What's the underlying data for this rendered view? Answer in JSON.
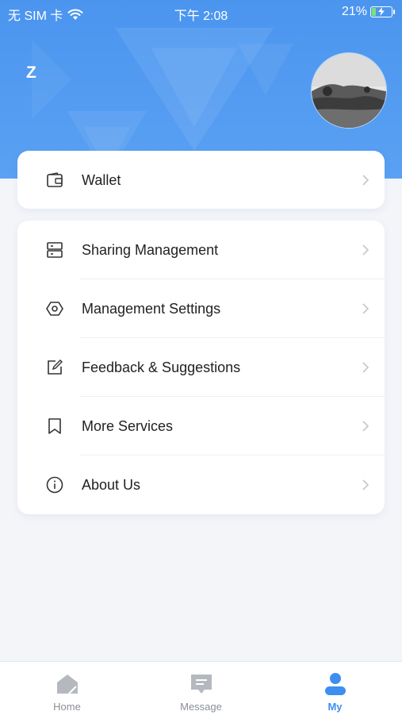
{
  "status_bar": {
    "carrier": "无 SIM 卡",
    "time": "下午 2:08",
    "battery_percent": "21%",
    "battery_level": 0.21
  },
  "profile": {
    "username": "Z"
  },
  "wallet_card": {
    "label": "Wallet",
    "icon": "wallet-icon"
  },
  "menu": {
    "items": [
      {
        "label": "Sharing Management",
        "icon": "server-icon"
      },
      {
        "label": "Management Settings",
        "icon": "settings-hexagon-icon"
      },
      {
        "label": "Feedback & Suggestions",
        "icon": "edit-icon"
      },
      {
        "label": "More Services",
        "icon": "bookmark-icon"
      },
      {
        "label": "About Us",
        "icon": "info-icon"
      }
    ]
  },
  "tabbar": {
    "tabs": [
      {
        "label": "Home",
        "icon": "home-icon",
        "active": false
      },
      {
        "label": "Message",
        "icon": "message-icon",
        "active": false
      },
      {
        "label": "My",
        "icon": "user-icon",
        "active": true
      }
    ]
  },
  "colors": {
    "accent": "#3d8ef0",
    "header": "#4b95ef",
    "inactive": "#b5b9bf"
  }
}
